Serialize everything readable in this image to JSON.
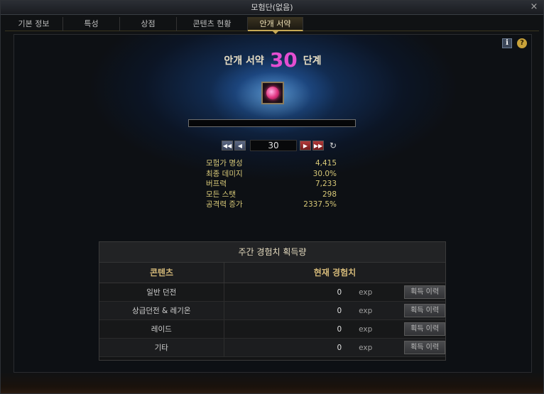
{
  "window": {
    "title": "모험단(없음)",
    "close_icon": "×"
  },
  "tabs": [
    {
      "label": "기본 정보",
      "active": false
    },
    {
      "label": "특성",
      "active": false
    },
    {
      "label": "상점",
      "active": false
    },
    {
      "label": "콘텐츠 현황",
      "active": false
    },
    {
      "label": "안개 서약",
      "active": true
    }
  ],
  "header_icons": {
    "info": "i",
    "help": "?"
  },
  "level": {
    "prefix": "안개 서약",
    "number": "30",
    "suffix": "단계"
  },
  "progress": {
    "fraction": 0
  },
  "stepper": {
    "value": "30",
    "first": "◀◀",
    "prev": "◀",
    "next": "▶",
    "last": "▶▶",
    "reset": "↻"
  },
  "stats": [
    {
      "label": "모험가 명성",
      "value": "4,415"
    },
    {
      "label": "최종 데미지",
      "value": "30.0%"
    },
    {
      "label": "버프력",
      "value": "7,233"
    },
    {
      "label": "모든 스탯",
      "value": "298"
    },
    {
      "label": "공격력 증가",
      "value": "2337.5%"
    }
  ],
  "weekly_panel": {
    "title": "주간 경험치 획득량",
    "col_content": "콘텐츠",
    "col_exp": "현재 경험치",
    "unit": "exp",
    "history_button": "획득 이력",
    "rows": [
      {
        "name": "일반 던전",
        "value": "0"
      },
      {
        "name": "상급던전 & 레기온",
        "value": "0"
      },
      {
        "name": "레이드",
        "value": "0"
      },
      {
        "name": "기타",
        "value": "0"
      }
    ]
  },
  "colors": {
    "accent_gold": "#c6a955",
    "level_number": "#e44ed1",
    "stat_text": "#d8c978"
  }
}
